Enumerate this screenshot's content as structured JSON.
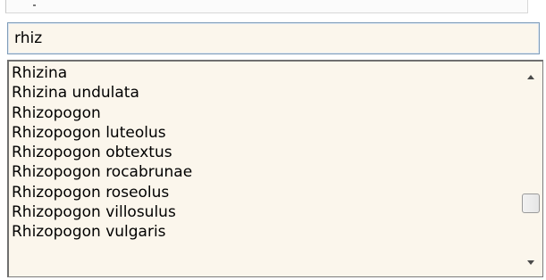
{
  "search": {
    "value": "rhiz"
  },
  "list": {
    "items": [
      "Rhizina",
      "Rhizina undulata",
      "Rhizopogon",
      "Rhizopogon luteolus",
      "Rhizopogon obtextus",
      "Rhizopogon rocabrunae",
      "Rhizopogon roseolus",
      "Rhizopogon villosulus",
      "Rhizopogon vulgaris"
    ]
  },
  "icons": {
    "scroll_up": "triangle-up-icon",
    "scroll_down": "triangle-down-icon"
  },
  "colors": {
    "field_background": "#fbf6ec",
    "field_border": "#7f9db9",
    "list_border": "#6f6f6f"
  }
}
